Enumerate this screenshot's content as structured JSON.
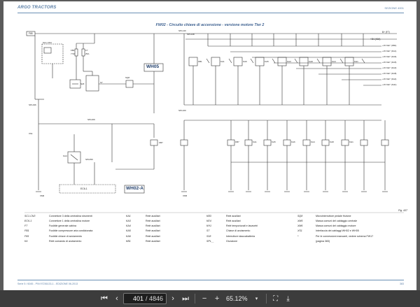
{
  "header": {
    "logo": "ARGO TRACTORS",
    "section": "SEZIONE 4001",
    "title": "FW02 - Circuito chiave di accensione - versione motore Tier 2"
  },
  "labels": {
    "wh05": "WH05",
    "wh02a": "WH02-A",
    "f65": "F65",
    "b_f7": "B+ (F7)",
    "k64": "+B4 (K64)",
    "ec6": "EC6-1",
    "fb1": "FB1",
    "fb1_val": "7.5A",
    "f7": "F7",
    "f7_val": "25A",
    "sc1": "SC1-CN3",
    "xs1": "XS1",
    "s18": "S18",
    "s7": "S7",
    "sq8": "SQ8",
    "spl196": "SPL196",
    "spl209": "SPL209",
    "spl050": "SPL050",
    "ka4": "KA4",
    "kb7": "KB7",
    "spl140": "SPL140",
    "spl148": "SPL148",
    "spl160": "SPL160",
    "xm6": "XM6",
    "xm5": "XM5"
  },
  "top_relays": [
    "KB1",
    "KA1",
    "KA6",
    "KA5",
    "KA3",
    "KA8",
    "KA4",
    "KH1"
  ],
  "lower_relays": [
    "KB7",
    "KA1",
    "KA5",
    "KA6",
    "KA4",
    "KA8",
    "KH1"
  ],
  "key_outputs": [
    "+15 KEY (KB1)",
    "+15 KEY (KA1)",
    "+15 KEY (KA6)",
    "+15 KEY (KA5)",
    "+15 KEY (KA3)",
    "+15 KEY (KA8)",
    "+15 KEY (KA4)",
    "+15 KEY (KH1)"
  ],
  "legend": {
    "col1": [
      {
        "code": "SC1-CN3",
        "text": "Connettore 3 della centralina strumenti"
      },
      {
        "code": "EC6-1",
        "text": "Connettore 1 della centralina motore"
      },
      {
        "code": "F7",
        "text": "Fusibile generale cabina"
      },
      {
        "code": "FB1",
        "text": "Fusibile compressore aria condizionata"
      },
      {
        "code": "F65",
        "text": "Fusibile chiave di avviamento"
      },
      {
        "code": "K4",
        "text": "Relè comando di avviamento"
      }
    ],
    "col2": [
      {
        "code": "KA1",
        "text": "Relè ausiliari"
      },
      {
        "code": "KA3",
        "text": "Relè ausiliari"
      },
      {
        "code": "KA4",
        "text": "Relè ausiliari"
      },
      {
        "code": "KA5",
        "text": "Relè ausiliari"
      },
      {
        "code": "KA6",
        "text": "Relè ausiliari"
      },
      {
        "code": "KB1",
        "text": "Relè ausiliari"
      }
    ],
    "col3": [
      {
        "code": "KB3",
        "text": "Relè ausiliari"
      },
      {
        "code": "KE4",
        "text": "Relè ausiliari"
      },
      {
        "code": "KH1",
        "text": "Relè temporizzati e lavavetri"
      },
      {
        "code": "S7",
        "text": "Chiave di avviamento"
      },
      {
        "code": "S18",
        "text": "Interruttore staccabatteria"
      },
      {
        "code": "SPL__",
        "text": "Giunzione"
      }
    ],
    "col4": [
      {
        "code": "SQ8",
        "text": "Microinterruttore pedale frizione"
      },
      {
        "code": "XM5",
        "text": "Massa comuni del cablaggio centrale"
      },
      {
        "code": "XM6",
        "text": "Massa comuni del cablaggio motore"
      },
      {
        "code": "XS1",
        "text": "Interfaccia dei cablaggi WH02 e WH05"
      },
      {
        "code": "*",
        "text": "Per le connessioni mancanti, vedere schema FW17"
      },
      {
        "code": "",
        "text": "(pagina 383)"
      }
    ]
  },
  "figure_label": "Fig. 437",
  "footer": {
    "left": "Serie 5 / 6045 - P/N 97236133-1 - EDIZIONE 06-2013",
    "page": "383"
  },
  "toolbar": {
    "current_page": "401",
    "total_pages": "/ 4846",
    "zoom": "65.12%"
  },
  "colors": {
    "accent": "#5b7fa6",
    "title": "#3b5f8f",
    "line": "#333333",
    "toolbar": "#3c3c3c"
  }
}
